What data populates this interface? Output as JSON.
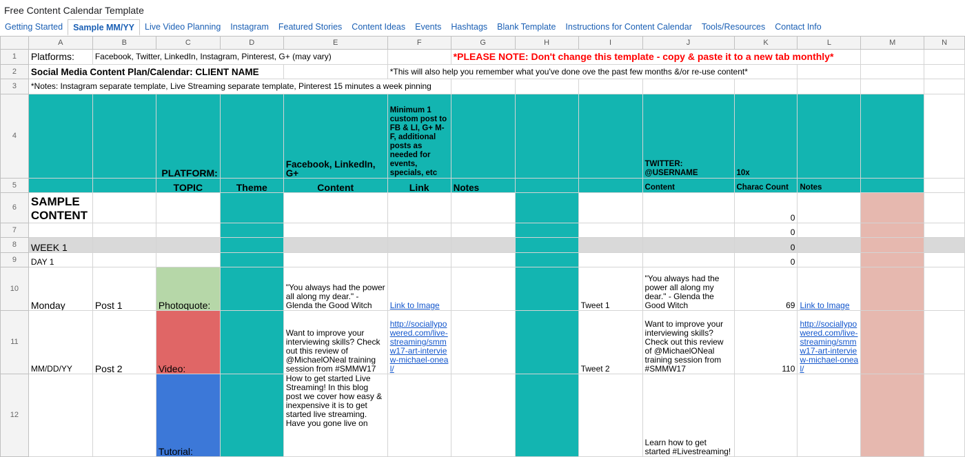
{
  "app_title": "Free Content Calendar Template",
  "tabs": [
    {
      "label": "Getting Started"
    },
    {
      "label": "Sample MM/YY",
      "active": true
    },
    {
      "label": "Live Video Planning"
    },
    {
      "label": "Instagram"
    },
    {
      "label": "Featured Stories"
    },
    {
      "label": "Content Ideas"
    },
    {
      "label": "Events"
    },
    {
      "label": "Hashtags"
    },
    {
      "label": "Blank Template"
    },
    {
      "label": "Instructions for Content Calendar"
    },
    {
      "label": "Tools/Resources"
    },
    {
      "label": "Contact Info"
    }
  ],
  "columns": [
    "A",
    "B",
    "C",
    "D",
    "E",
    "F",
    "G",
    "H",
    "I",
    "J",
    "K",
    "L",
    "M",
    "N"
  ],
  "row_numbers": [
    "1",
    "2",
    "3",
    "4",
    "5",
    "6",
    "7",
    "8",
    "9",
    "10",
    "11",
    "12"
  ],
  "colors": {
    "teal": "#13b5b1",
    "pink": "#e6b8af",
    "grey": "#d9d9d9",
    "green": "#b6d7a8",
    "red": "#e06666",
    "blue": "#3c78d8",
    "link": "#1155cc",
    "warning": "#ff0000"
  },
  "cells": {
    "A1": "Platforms:",
    "B1": "Facebook, Twitter, LinkedIn, Instagram, Pinterest, G+ (may vary)",
    "H1": "*PLEASE NOTE: Don't change this template - copy & paste it to a new tab monthly*",
    "A2": "Social Media Content Plan/Calendar: CLIENT NAME",
    "H2": "*This will also help you remember what you've done ove the past few months &/or re-use content*",
    "A3": "*Notes: Instagram separate template, Live Streaming separate template, Pinterest 15 minutes a week pinning",
    "C4": "PLATFORM:",
    "E4": "Facebook, LinkedIn, G+",
    "F4": "Minimum 1 custom post to FB & LI, G+ M-F, additional posts as needed for events, specials, etc",
    "J4": "TWITTER: @USERNAME",
    "K4": "10x",
    "C5": "TOPIC",
    "D5": "Theme",
    "E5": "Content",
    "F5": "Link",
    "G5": "Notes",
    "J5": "Content",
    "K5": "Charac Count",
    "L5": "Notes",
    "A6": "SAMPLE CONTENT",
    "K6": "0",
    "K7": "0",
    "A8": "WEEK 1",
    "K8": "0",
    "A9": "DAY 1",
    "K9": "0",
    "A10": "Monday",
    "B10": "Post 1",
    "C10": "Photoquote:",
    "E10": "\"You always had the power all along my dear.\" - Glenda the Good Witch",
    "F10": "Link to Image",
    "I10": "Tweet 1",
    "J10": "\"You always had the power all along my dear.\" - Glenda the Good Witch",
    "K10": "69",
    "L10": "Link to Image",
    "A11": "MM/DD/YY",
    "B11": "Post 2",
    "C11": "Video:",
    "E11": "Want to improve your interviewing skills? Check out this review of @MichaelONeal training session from #SMMW17",
    "F11": "http://sociallypowered.com/live-streaming/smmw17-art-interview-michael-oneal/",
    "I11": "Tweet 2",
    "J11": "Want to improve your interviewing skills? Check out this review of @MichaelONeal training session from #SMMW17",
    "K11": "110",
    "L11": "http://sociallypowered.com/live-streaming/smmw17-art-interview-michael-oneal/",
    "C12": "Tutorial:",
    "E12": "How to get started Live Streaming! In this blog post we cover how easy & inexpensive it is to get started live streaming. Have you gone live on",
    "J12": "Learn how to get started #Livestreaming!"
  }
}
